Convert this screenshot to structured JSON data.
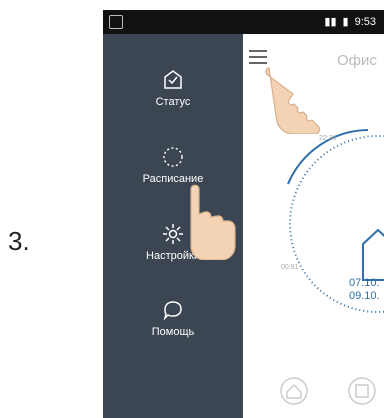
{
  "step": "3.",
  "statusbar": {
    "time": "9:53"
  },
  "menu": {
    "items": [
      {
        "label": "Статус",
        "icon": "shield-check-icon"
      },
      {
        "label": "Расписание",
        "icon": "dotted-circle-icon"
      },
      {
        "label": "Настройки",
        "icon": "gear-icon"
      },
      {
        "label": "Помощь",
        "icon": "speech-bubble-icon"
      }
    ]
  },
  "content": {
    "title": "Офис",
    "dial_tick": "22:30",
    "dial_left": "00:91",
    "dates": [
      "07.10.",
      "09.10."
    ]
  },
  "colors": {
    "drawer": "#3b4652",
    "accent": "#2f6ea8"
  }
}
